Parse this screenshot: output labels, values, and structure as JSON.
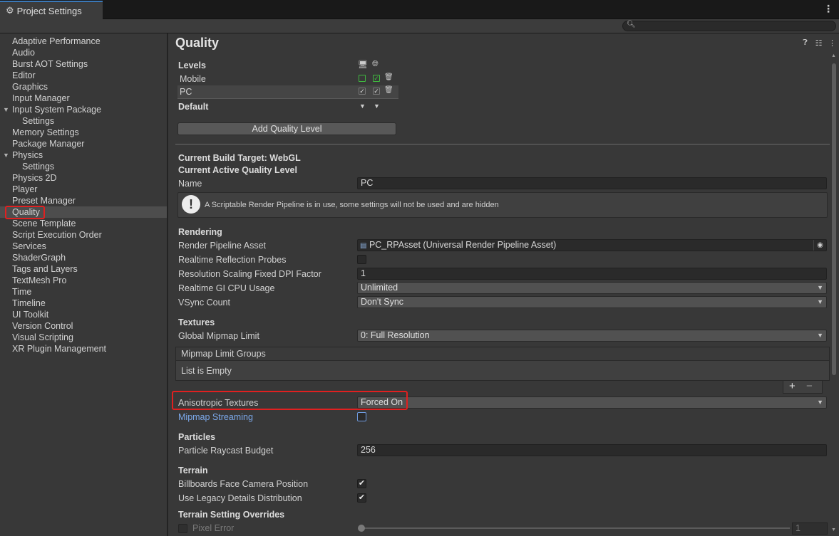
{
  "window": {
    "tab_title": "Project Settings"
  },
  "sidebar": {
    "items": [
      {
        "label": "Adaptive Performance"
      },
      {
        "label": "Audio"
      },
      {
        "label": "Burst AOT Settings"
      },
      {
        "label": "Editor"
      },
      {
        "label": "Graphics"
      },
      {
        "label": "Input Manager"
      },
      {
        "label": "Input System Package"
      },
      {
        "label": "Settings"
      },
      {
        "label": "Memory Settings"
      },
      {
        "label": "Package Manager"
      },
      {
        "label": "Physics"
      },
      {
        "label": "Settings"
      },
      {
        "label": "Physics 2D"
      },
      {
        "label": "Player"
      },
      {
        "label": "Preset Manager"
      },
      {
        "label": "Quality"
      },
      {
        "label": "Scene Template"
      },
      {
        "label": "Script Execution Order"
      },
      {
        "label": "Services"
      },
      {
        "label": "ShaderGraph"
      },
      {
        "label": "Tags and Layers"
      },
      {
        "label": "TextMesh Pro"
      },
      {
        "label": "Time"
      },
      {
        "label": "Timeline"
      },
      {
        "label": "UI Toolkit"
      },
      {
        "label": "Version Control"
      },
      {
        "label": "Visual Scripting"
      },
      {
        "label": "XR Plugin Management"
      }
    ]
  },
  "main": {
    "title": "Quality",
    "levels": {
      "header": "Levels",
      "rows": [
        {
          "name": "Mobile"
        },
        {
          "name": "PC"
        }
      ],
      "default_label": "Default",
      "add_button": "Add Quality Level"
    },
    "current_build_target": "Current Build Target: WebGL",
    "current_active_level": "Current Active Quality Level",
    "name_label": "Name",
    "name_value": "PC",
    "help_message": "A Scriptable Render Pipeline is in use, some settings will not be used and are hidden",
    "rendering": {
      "header": "Rendering",
      "pipeline_asset_label": "Render Pipeline Asset",
      "pipeline_asset_value": "PC_RPAsset (Universal Render Pipeline Asset)",
      "reflection_probes_label": "Realtime Reflection Probes",
      "dpi_label": "Resolution Scaling Fixed DPI Factor",
      "dpi_value": "1",
      "gi_label": "Realtime GI CPU Usage",
      "gi_value": "Unlimited",
      "vsync_label": "VSync Count",
      "vsync_value": "Don't Sync"
    },
    "textures": {
      "header": "Textures",
      "mipmap_limit_label": "Global Mipmap Limit",
      "mipmap_limit_value": "0: Full Resolution",
      "groups_header": "Mipmap Limit Groups",
      "groups_empty": "List is Empty",
      "aniso_label": "Anisotropic Textures",
      "aniso_value": "Forced On",
      "streaming_label": "Mipmap Streaming"
    },
    "particles": {
      "header": "Particles",
      "raycast_label": "Particle Raycast Budget",
      "raycast_value": "256"
    },
    "terrain": {
      "header": "Terrain",
      "billboards_label": "Billboards Face Camera Position",
      "legacy_label": "Use Legacy Details Distribution",
      "overrides_header": "Terrain Setting Overrides",
      "pixel_error_label": "Pixel Error",
      "pixel_error_value": "1"
    }
  },
  "colors": {
    "highlight": "#e02020",
    "link": "#7ba7e8",
    "check_green": "#3fb83f"
  }
}
